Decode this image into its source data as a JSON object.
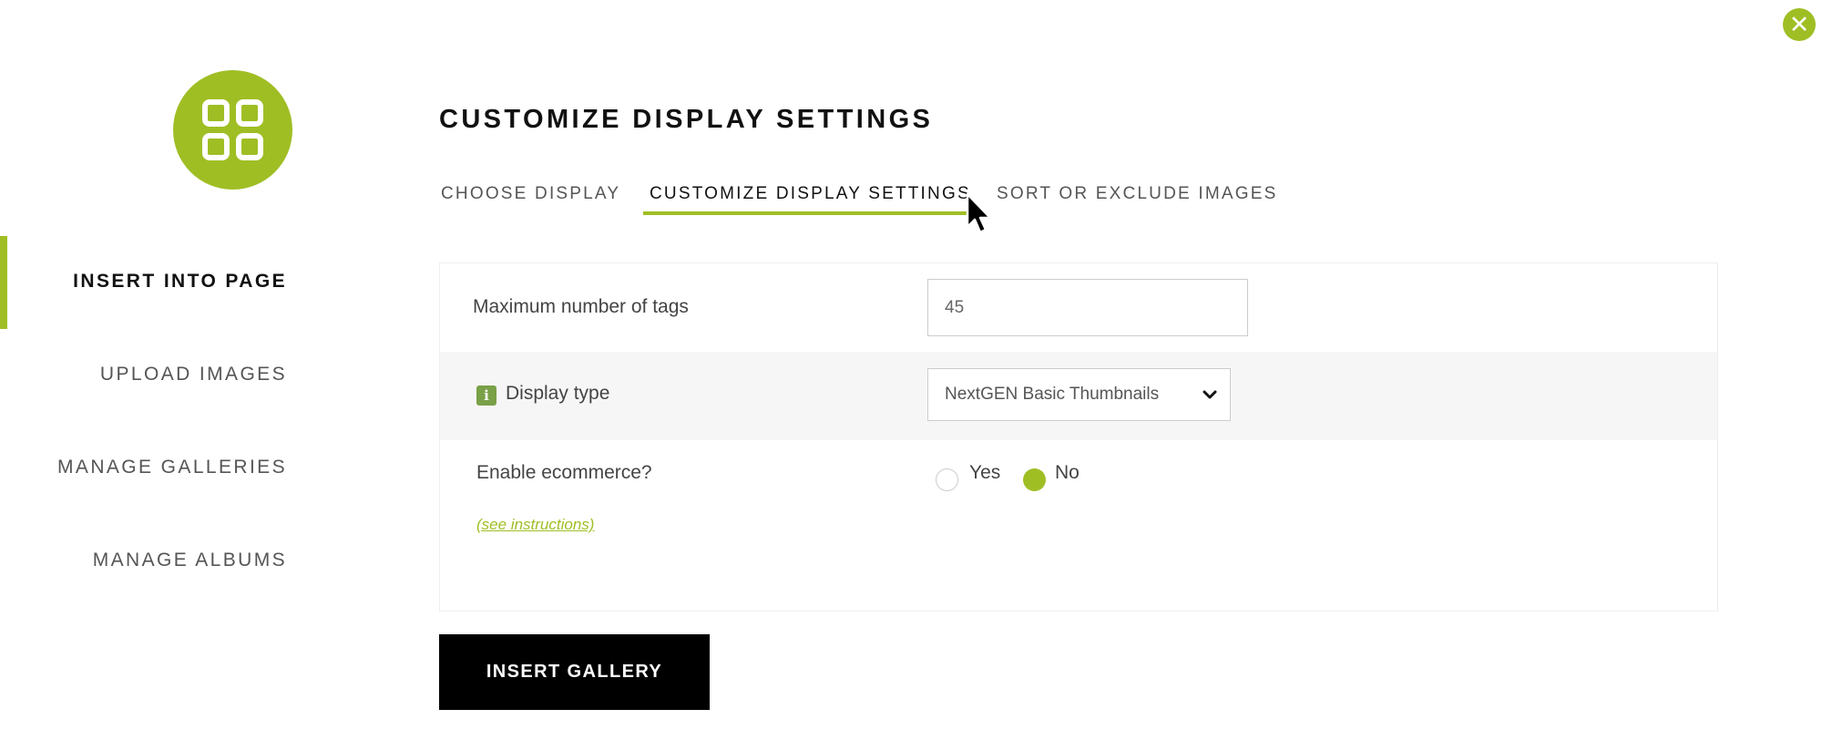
{
  "window": {
    "close_icon": "close-icon"
  },
  "sidebar": {
    "logo_icon": "gallery-grid-icon",
    "items": [
      {
        "label": "INSERT INTO PAGE",
        "active": true
      },
      {
        "label": "UPLOAD IMAGES",
        "active": false
      },
      {
        "label": "MANAGE GALLERIES",
        "active": false
      },
      {
        "label": "MANAGE ALBUMS",
        "active": false
      }
    ]
  },
  "main": {
    "title": "CUSTOMIZE DISPLAY SETTINGS",
    "tabs": [
      {
        "label": "CHOOSE DISPLAY",
        "active": false
      },
      {
        "label": "CUSTOMIZE DISPLAY SETTINGS",
        "active": true
      },
      {
        "label": "SORT OR EXCLUDE IMAGES",
        "active": false
      }
    ]
  },
  "settings": {
    "max_tags": {
      "label": "Maximum number of tags",
      "value": "45"
    },
    "display_type": {
      "label": "Display type",
      "info_icon_text": "i",
      "selected": "NextGEN Basic Thumbnails"
    },
    "ecommerce": {
      "label": "Enable ecommerce?",
      "options": [
        {
          "label": "Yes",
          "checked": false
        },
        {
          "label": "No",
          "checked": true
        }
      ],
      "link": "(see instructions)"
    }
  },
  "actions": {
    "insert_label": "INSERT GALLERY"
  },
  "colors": {
    "accent": "#9fbe24",
    "button_bg": "#000000",
    "row_alt_bg": "#f6f6f6",
    "info_icon_bg": "#7aa048"
  }
}
